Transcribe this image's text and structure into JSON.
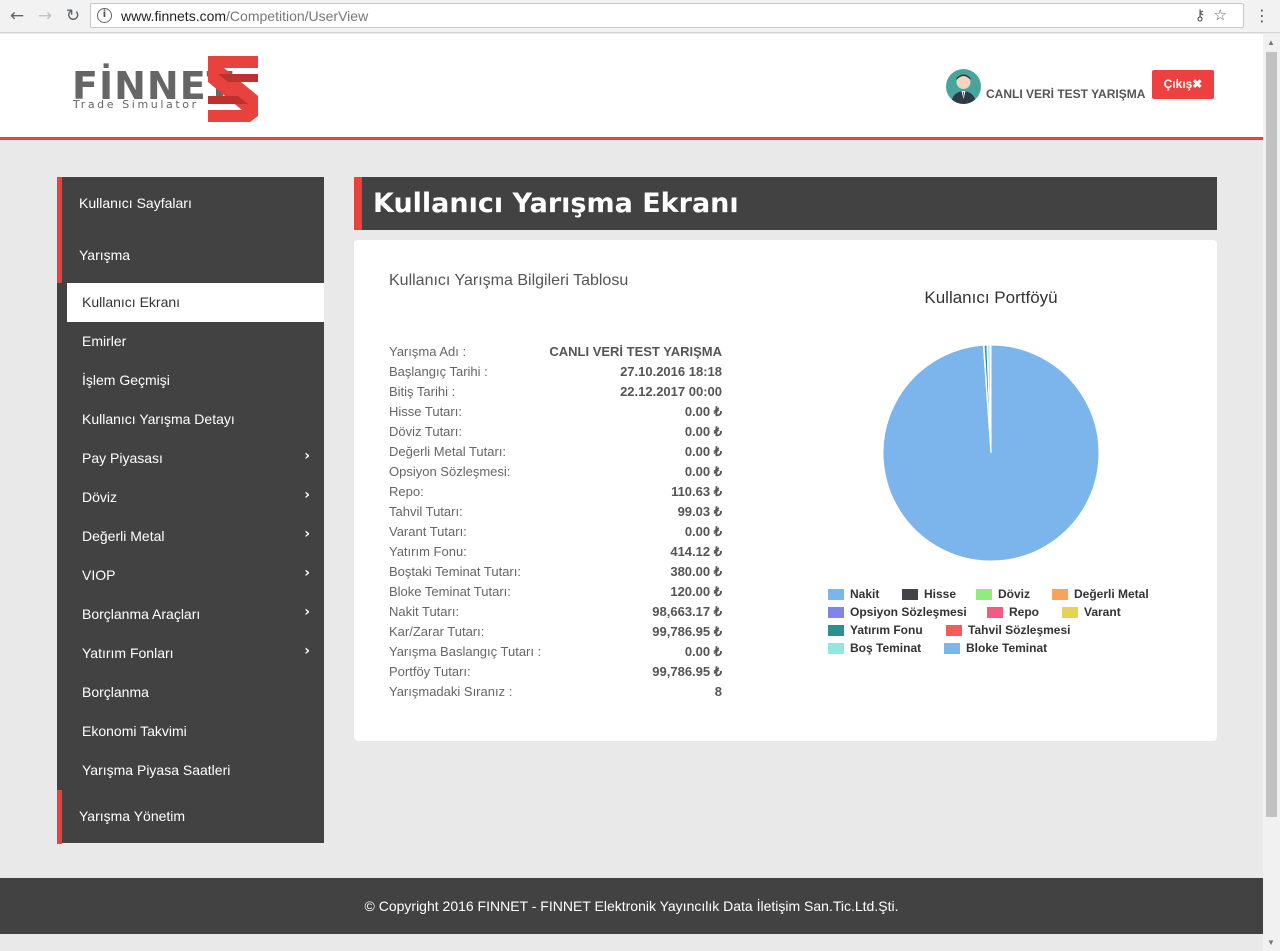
{
  "browser": {
    "url_host": "www.finnets.com",
    "url_path": "/Competition/UserView"
  },
  "header": {
    "logo_text": "FİNNET",
    "logo_subtitle": "Trade Simulator",
    "user_name": "CANLI VERİ TEST YARIŞMA",
    "logout_label": "Çıkış✖"
  },
  "sidebar": {
    "sections": [
      {
        "label": "Kullanıcı Sayfaları"
      },
      {
        "label": "Yarışma"
      },
      {
        "label": "Yarışma Yönetim"
      }
    ],
    "items": [
      {
        "label": "Kullanıcı Ekranı",
        "active": true,
        "submenu": false
      },
      {
        "label": "Emirler",
        "submenu": false
      },
      {
        "label": "İşlem Geçmişi",
        "submenu": false
      },
      {
        "label": "Kullanıcı Yarışma Detayı",
        "submenu": false
      },
      {
        "label": "Pay Piyasası",
        "submenu": true
      },
      {
        "label": "Döviz",
        "submenu": true
      },
      {
        "label": "Değerli Metal",
        "submenu": true
      },
      {
        "label": "VIOP",
        "submenu": true
      },
      {
        "label": "Borçlanma Araçları",
        "submenu": true
      },
      {
        "label": "Yatırım Fonları",
        "submenu": true
      },
      {
        "label": "Borçlanma",
        "submenu": false
      },
      {
        "label": "Ekonomi Takvimi",
        "submenu": false
      },
      {
        "label": "Yarışma Piyasa Saatleri",
        "submenu": false
      }
    ]
  },
  "main": {
    "page_title": "Kullanıcı Yarışma Ekranı",
    "table_title": "Kullanıcı Yarışma Bilgileri Tablosu",
    "rows": [
      {
        "key": "Yarışma Adı :",
        "value": "CANLI VERİ TEST YARIŞMA"
      },
      {
        "key": "Başlangıç Tarihi :",
        "value": "27.10.2016 18:18"
      },
      {
        "key": "Bitiş Tarihi :",
        "value": "22.12.2017 00:00"
      },
      {
        "key": "Hisse Tutarı:",
        "value": "0.00 ₺"
      },
      {
        "key": "Döviz Tutarı:",
        "value": "0.00 ₺"
      },
      {
        "key": "Değerli Metal Tutarı:",
        "value": "0.00 ₺"
      },
      {
        "key": "Opsiyon Sözleşmesi:",
        "value": "0.00 ₺"
      },
      {
        "key": "Repo:",
        "value": "110.63 ₺"
      },
      {
        "key": "Tahvil Tutarı:",
        "value": "99.03 ₺"
      },
      {
        "key": "Varant Tutarı:",
        "value": "0.00 ₺"
      },
      {
        "key": "Yatırım Fonu:",
        "value": "414.12 ₺"
      },
      {
        "key": "Boştaki Teminat Tutarı:",
        "value": "380.00 ₺"
      },
      {
        "key": "Bloke Teminat Tutarı:",
        "value": "120.00 ₺"
      },
      {
        "key": "Nakit Tutarı:",
        "value": "98,663.17 ₺"
      },
      {
        "key": "Kar/Zarar Tutarı:",
        "value": "99,786.95 ₺"
      },
      {
        "key": "Yarışma Baslangıç Tutarı :",
        "value": "0.00 ₺"
      },
      {
        "key": "Portföy Tutarı:",
        "value": "99,786.95 ₺"
      },
      {
        "key": "Yarışmadaki Sıranız :",
        "value": "8"
      }
    ]
  },
  "chart_data": {
    "type": "pie",
    "title": "Kullanıcı Portföyü",
    "legend_position": "bottom",
    "slices": [
      {
        "name": "Nakit",
        "value": 98663.17,
        "color": "#7cb5ec"
      },
      {
        "name": "Hisse",
        "value": 0,
        "color": "#434348"
      },
      {
        "name": "Döviz",
        "value": 0,
        "color": "#90ed7d"
      },
      {
        "name": "Değerli Metal",
        "value": 0,
        "color": "#f7a35c"
      },
      {
        "name": "Opsiyon Sözleşmesi",
        "value": 0,
        "color": "#8085e9"
      },
      {
        "name": "Repo",
        "value": 110.63,
        "color": "#f15c80"
      },
      {
        "name": "Varant",
        "value": 0,
        "color": "#e4d354"
      },
      {
        "name": "Yatırım Fonu",
        "value": 414.12,
        "color": "#2b908f"
      },
      {
        "name": "Tahvil Sözleşmesi",
        "value": 99.03,
        "color": "#f45b5b"
      },
      {
        "name": "Boş Teminat",
        "value": 380.0,
        "color": "#91e8e1"
      },
      {
        "name": "Bloke Teminat",
        "value": 120.0,
        "color": "#7cb5ec"
      }
    ]
  },
  "footer": {
    "text": "© Copyright 2016 FINNET - FINNET Elektronik Yayıncılık Data İletişim San.Tic.Ltd.Şti."
  }
}
